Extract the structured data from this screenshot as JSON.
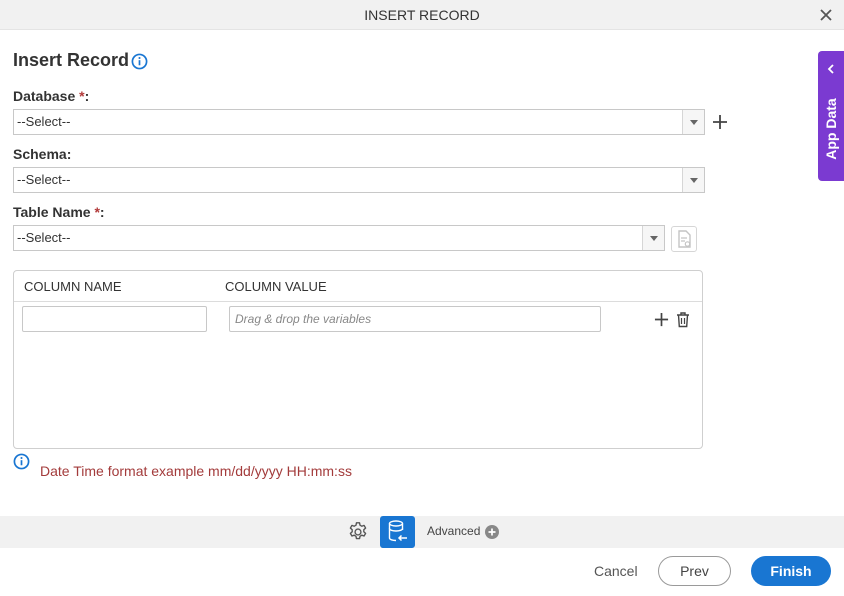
{
  "window": {
    "title": "INSERT RECORD"
  },
  "form": {
    "heading": "Insert Record",
    "database": {
      "label": "Database",
      "required_mark": "*",
      "suffix": ":",
      "value": "--Select--"
    },
    "schema": {
      "label": "Schema:",
      "value": "--Select--"
    },
    "table": {
      "label": "Table Name",
      "required_mark": "*",
      "suffix": ":",
      "value": "--Select--"
    }
  },
  "grid": {
    "col_name": "COLUMN NAME",
    "col_value": "COLUMN VALUE",
    "row": {
      "name_value": "",
      "value_placeholder": "Drag & drop the variables"
    }
  },
  "note": "Date Time format example mm/dd/yyyy HH:mm:ss",
  "toolbar": {
    "advanced_label": "Advanced"
  },
  "footer": {
    "cancel": "Cancel",
    "prev": "Prev",
    "finish": "Finish"
  },
  "side_panel": {
    "label": "App Data"
  },
  "colors": {
    "primary": "#1976d2",
    "panel": "#7b3ad1",
    "required": "#b23a3a",
    "note": "#a33b3b"
  }
}
